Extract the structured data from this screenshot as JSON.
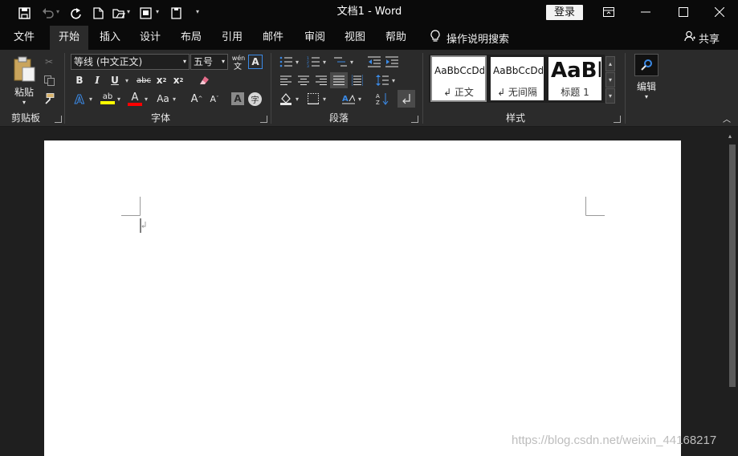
{
  "window": {
    "title": "文档1  -  Word",
    "login_label": "登录"
  },
  "tabs": [
    "文件",
    "开始",
    "插入",
    "设计",
    "布局",
    "引用",
    "邮件",
    "审阅",
    "视图",
    "帮助"
  ],
  "active_tab": "开始",
  "tell_me": "操作说明搜索",
  "share": "共享",
  "clipboard": {
    "paste_label": "粘贴",
    "group_label": "剪贴板"
  },
  "font": {
    "font_name": "等线 (中文正文)",
    "font_size": "五号",
    "phonetic_glyph": "wén",
    "group_label": "字体"
  },
  "paragraph": {
    "group_label": "段落"
  },
  "styles": {
    "items": [
      {
        "sample": "AaBbCcDd",
        "name": "↲ 正文"
      },
      {
        "sample": "AaBbCcDd",
        "name": "↲ 无间隔"
      },
      {
        "sample": "AaBl",
        "name": "标题 1"
      }
    ],
    "group_label": "样式"
  },
  "editing": {
    "label": "编辑"
  },
  "watermark": "https://blog.csdn.net/weixin_44168217",
  "colors": {
    "titlebar": "#0a0a0a",
    "ribbon": "#2b2b2b",
    "workspace": "#1f1f1f",
    "highlight": "#ffff00",
    "font_color": "#ff0000",
    "accent_blue": "#3b8ae6"
  }
}
